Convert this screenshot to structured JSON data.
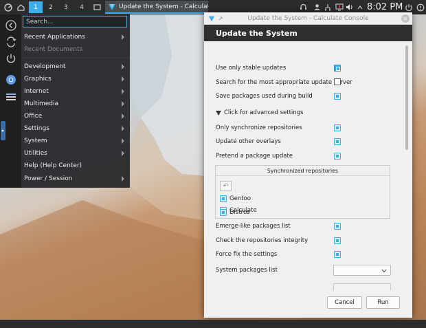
{
  "taskbar": {
    "desktops": [
      "1",
      "2",
      "3",
      "4"
    ],
    "active_desktop_index": 0,
    "task_title": "Update the System - Calculate Conso...",
    "clock": "8:02 PM"
  },
  "menu": {
    "search_placeholder": "Search...",
    "items": [
      {
        "label": "Recent Applications",
        "submenu": true,
        "enabled": true
      },
      {
        "label": "Recent Documents",
        "submenu": false,
        "enabled": false
      },
      {
        "label": "Development",
        "submenu": true,
        "enabled": true
      },
      {
        "label": "Graphics",
        "submenu": true,
        "enabled": true
      },
      {
        "label": "Internet",
        "submenu": true,
        "enabled": true
      },
      {
        "label": "Multimedia",
        "submenu": true,
        "enabled": true
      },
      {
        "label": "Office",
        "submenu": true,
        "enabled": true
      },
      {
        "label": "Settings",
        "submenu": true,
        "enabled": true
      },
      {
        "label": "System",
        "submenu": true,
        "enabled": true
      },
      {
        "label": "Utilities",
        "submenu": true,
        "enabled": true
      },
      {
        "label": "Help (Help Center)",
        "submenu": false,
        "enabled": true
      },
      {
        "label": "Power / Session",
        "submenu": true,
        "enabled": true
      }
    ]
  },
  "dialog": {
    "window_title": "Update the System - Calculate Console",
    "header": "Update the System",
    "options": [
      {
        "label": "Use only stable updates",
        "state": "solid"
      },
      {
        "label": "Search for the most appropriate update server",
        "state": "empty"
      },
      {
        "label": "Save packages used during build",
        "state": "checked"
      }
    ],
    "advanced_toggle": "Click for advanced settings",
    "advanced_options": [
      {
        "label": "Only synchronize repositories",
        "state": "checked"
      },
      {
        "label": "Update other overlays",
        "state": "checked"
      },
      {
        "label": "Pretend a package update",
        "state": "checked"
      }
    ],
    "sync_repos": {
      "header": "Synchronized repositories",
      "items": [
        "Gentoo",
        "Calculate",
        "Distros"
      ]
    },
    "more_options": [
      {
        "label": "Emerge-like packages list",
        "state": "checked"
      },
      {
        "label": "Check the repositories integrity",
        "state": "checked"
      },
      {
        "label": "Force fix the settings",
        "state": "checked"
      }
    ],
    "system_packages_label": "System packages list",
    "system_packages_value": "",
    "cancel_label": "Cancel",
    "run_label": "Run"
  },
  "colors": {
    "accent": "#3daee9",
    "panel": "#2b2c2e",
    "dialog_header": "#2e2f31"
  }
}
